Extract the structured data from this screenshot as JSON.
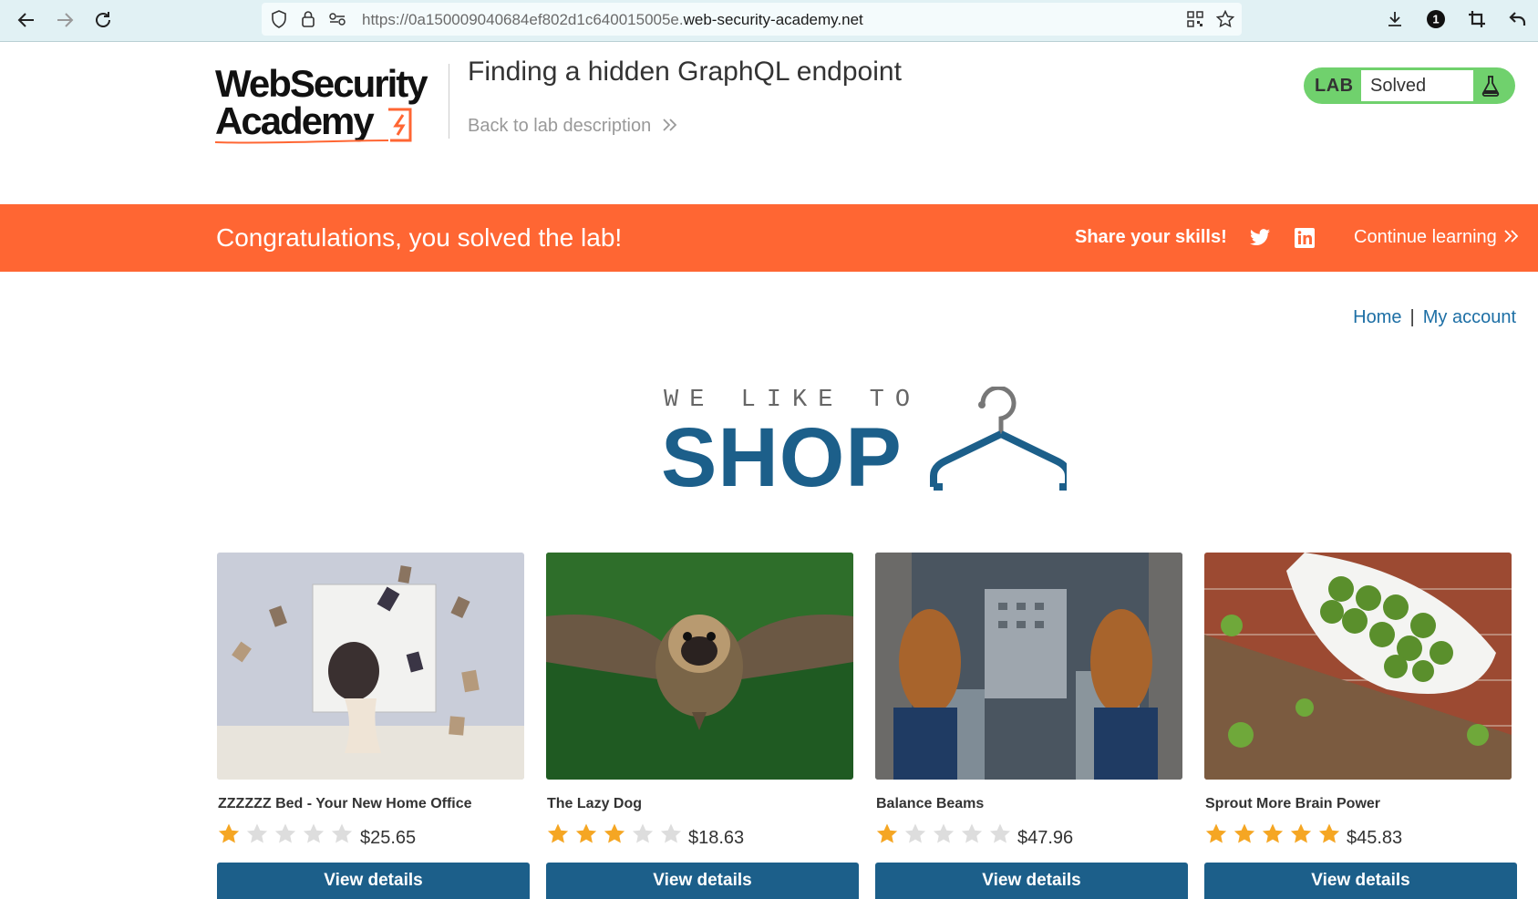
{
  "browser": {
    "url_prefix": "https://0a150009040684ef802d1c640015005e.",
    "url_domain": "web-security-academy.net",
    "badge_count": "1"
  },
  "header": {
    "logo_line1": "WebSecurity",
    "logo_line2": "Academy",
    "lab_title": "Finding a hidden GraphQL endpoint",
    "back_link": "Back to lab description",
    "lab_tag": "LAB",
    "lab_status": "Solved"
  },
  "banner": {
    "message": "Congratulations, you solved the lab!",
    "share_label": "Share your skills!",
    "continue_label": "Continue learning"
  },
  "nav": {
    "home": "Home",
    "separator": "|",
    "my_account": "My account"
  },
  "shop_logo": {
    "tagline": "WE LIKE TO",
    "word": "SHOP"
  },
  "products": [
    {
      "name": "ZZZZZZ Bed - Your New Home Office",
      "rating": 1,
      "price": "$25.65",
      "button": "View details"
    },
    {
      "name": "The Lazy Dog",
      "rating": 3,
      "price": "$18.63",
      "button": "View details"
    },
    {
      "name": "Balance Beams",
      "rating": 1,
      "price": "$47.96",
      "button": "View details"
    },
    {
      "name": "Sprout More Brain Power",
      "rating": 5,
      "price": "$45.83",
      "button": "View details"
    }
  ],
  "colors": {
    "banner": "#ff6633",
    "brand_blue": "#1c5f8a",
    "lab_green": "#70d16d",
    "star_on": "#f5a623",
    "star_off": "#dddddd"
  },
  "icons": [
    "back-arrow-icon",
    "forward-arrow-icon",
    "reload-icon",
    "shield-icon",
    "lock-icon",
    "permissions-icon",
    "qr-code-icon",
    "star-bookmark-icon",
    "download-icon",
    "extension-badge-icon",
    "crop-icon",
    "undo-icon",
    "flask-icon",
    "twitter-icon",
    "linkedin-icon",
    "hanger-icon"
  ]
}
